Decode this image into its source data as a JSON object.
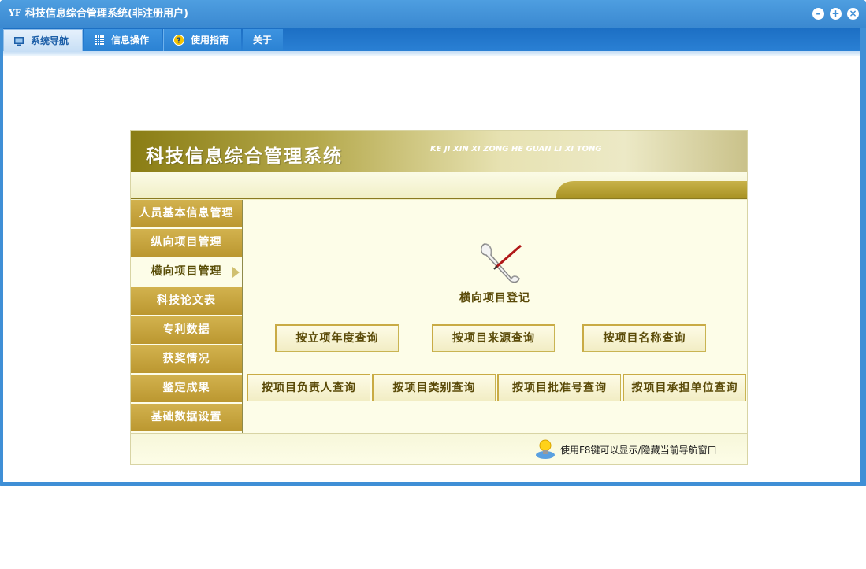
{
  "window": {
    "title": "科技信息综合管理系统(非注册用户)",
    "app_icon": "yf-logo-icon",
    "controls": [
      "minimize-icon",
      "restore-icon",
      "close-icon"
    ]
  },
  "tabs": [
    {
      "label": "系统导航",
      "icon": "monitor-icon",
      "active": true
    },
    {
      "label": "信息操作",
      "icon": "grid-icon",
      "active": false
    },
    {
      "label": "使用指南",
      "icon": "help-icon",
      "active": false
    },
    {
      "label": "关于",
      "icon": "",
      "active": false
    }
  ],
  "banner": {
    "title": "科技信息综合管理系统",
    "subtitle": "KE JI XIN XI ZONG HE GUAN LI XI TONG"
  },
  "sidebar": {
    "items": [
      {
        "label": "人员基本信息管理"
      },
      {
        "label": "纵向项目管理"
      },
      {
        "label": "横向项目管理",
        "active": true
      },
      {
        "label": "科技论文表"
      },
      {
        "label": "专利数据"
      },
      {
        "label": "获奖情况"
      },
      {
        "label": "鉴定成果"
      },
      {
        "label": "基础数据设置"
      }
    ]
  },
  "main": {
    "register_label": "横向项目登记",
    "register_icon": "scroll-quill-icon",
    "query_row1": [
      "按立项年度查询",
      "按项目来源查询",
      "按项目名称查询"
    ],
    "query_row2": [
      "按项目负责人查询",
      "按项目类别查询",
      "按项目批准号查询",
      "按项目承担单位查询"
    ]
  },
  "footer": {
    "hint": "使用F8键可以显示/隐藏当前导航窗口",
    "hint_icon": "lightbulb-icon"
  },
  "colors": {
    "title_blue": "#3f8fd6",
    "gold": "#c8a63c",
    "cream": "#fdfde8",
    "text_brown": "#5a4a08"
  }
}
